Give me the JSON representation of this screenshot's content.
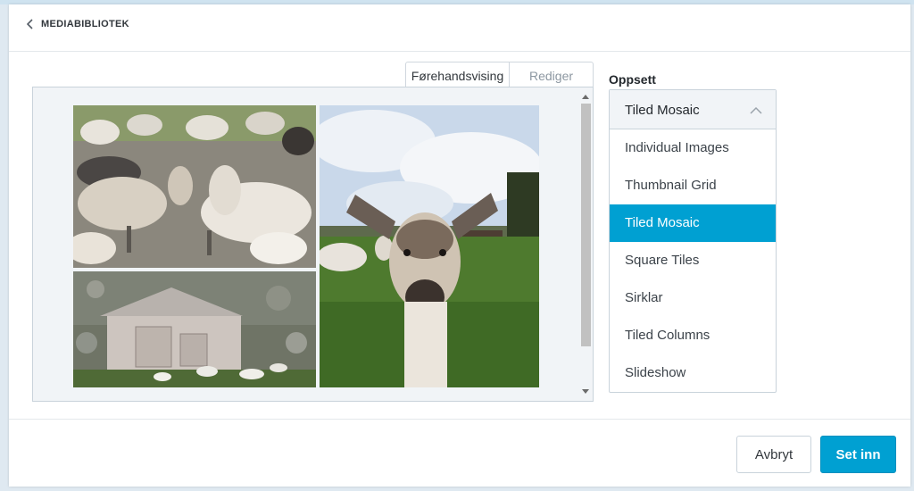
{
  "header": {
    "back_label": "MEDIABIBLIOTEK",
    "back_icon": "chevron-left-icon"
  },
  "tabs": [
    {
      "label": "Førehandsvising",
      "active": true
    },
    {
      "label": "Rediger",
      "active": false
    }
  ],
  "preview": {
    "tiles": [
      {
        "name": "goat-herd-photo",
        "description_icon": "image"
      },
      {
        "name": "goat-closeup-photo",
        "description_icon": "image"
      },
      {
        "name": "barn-photo",
        "description_icon": "image"
      }
    ]
  },
  "layout": {
    "label": "Oppsett",
    "selected": "Tiled Mosaic",
    "options": [
      "Individual Images",
      "Thumbnail Grid",
      "Tiled Mosaic",
      "Square Tiles",
      "Sirklar",
      "Tiled Columns",
      "Slideshow"
    ],
    "selected_index": 2
  },
  "footer": {
    "cancel_label": "Avbryt",
    "insert_label": "Set inn"
  },
  "colors": {
    "accent": "#00a0d2",
    "panel_bg": "#f1f4f7",
    "border": "#c9d3db"
  }
}
